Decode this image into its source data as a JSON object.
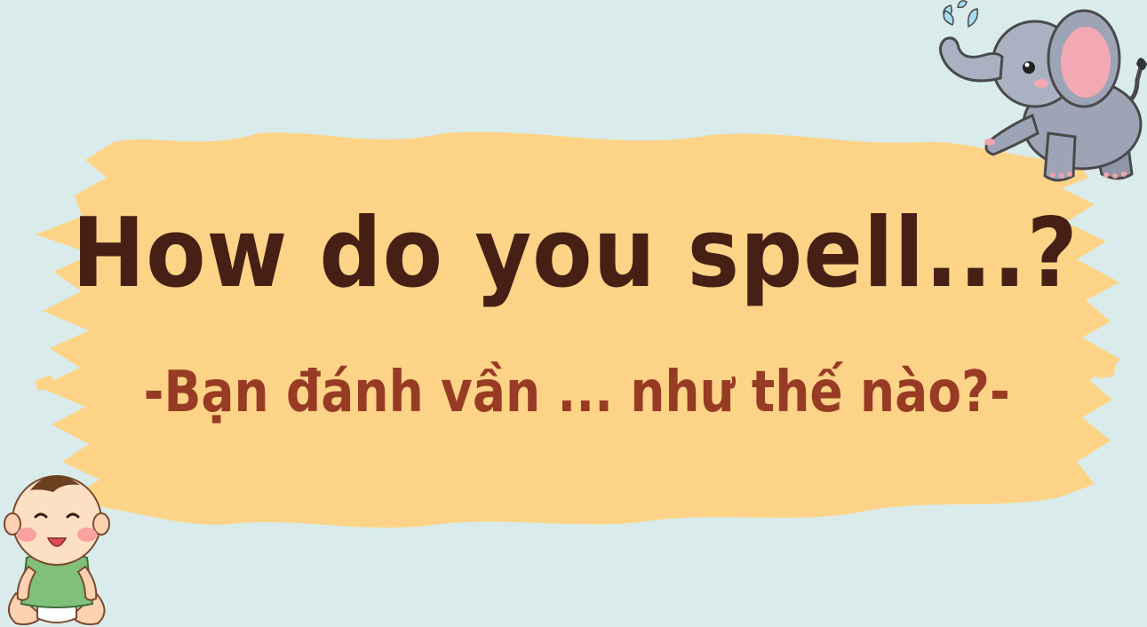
{
  "banner": {
    "title": "How do you spell...?",
    "subtitle": "-Bạn đánh vần ... như thế nào?-"
  },
  "colors": {
    "background": "#d9ebea",
    "brush": "#fdd487",
    "title": "#462015",
    "subtitle": "#983b25"
  },
  "illustrations": {
    "elephant": "elephant-illustration",
    "baby": "baby-illustration"
  }
}
